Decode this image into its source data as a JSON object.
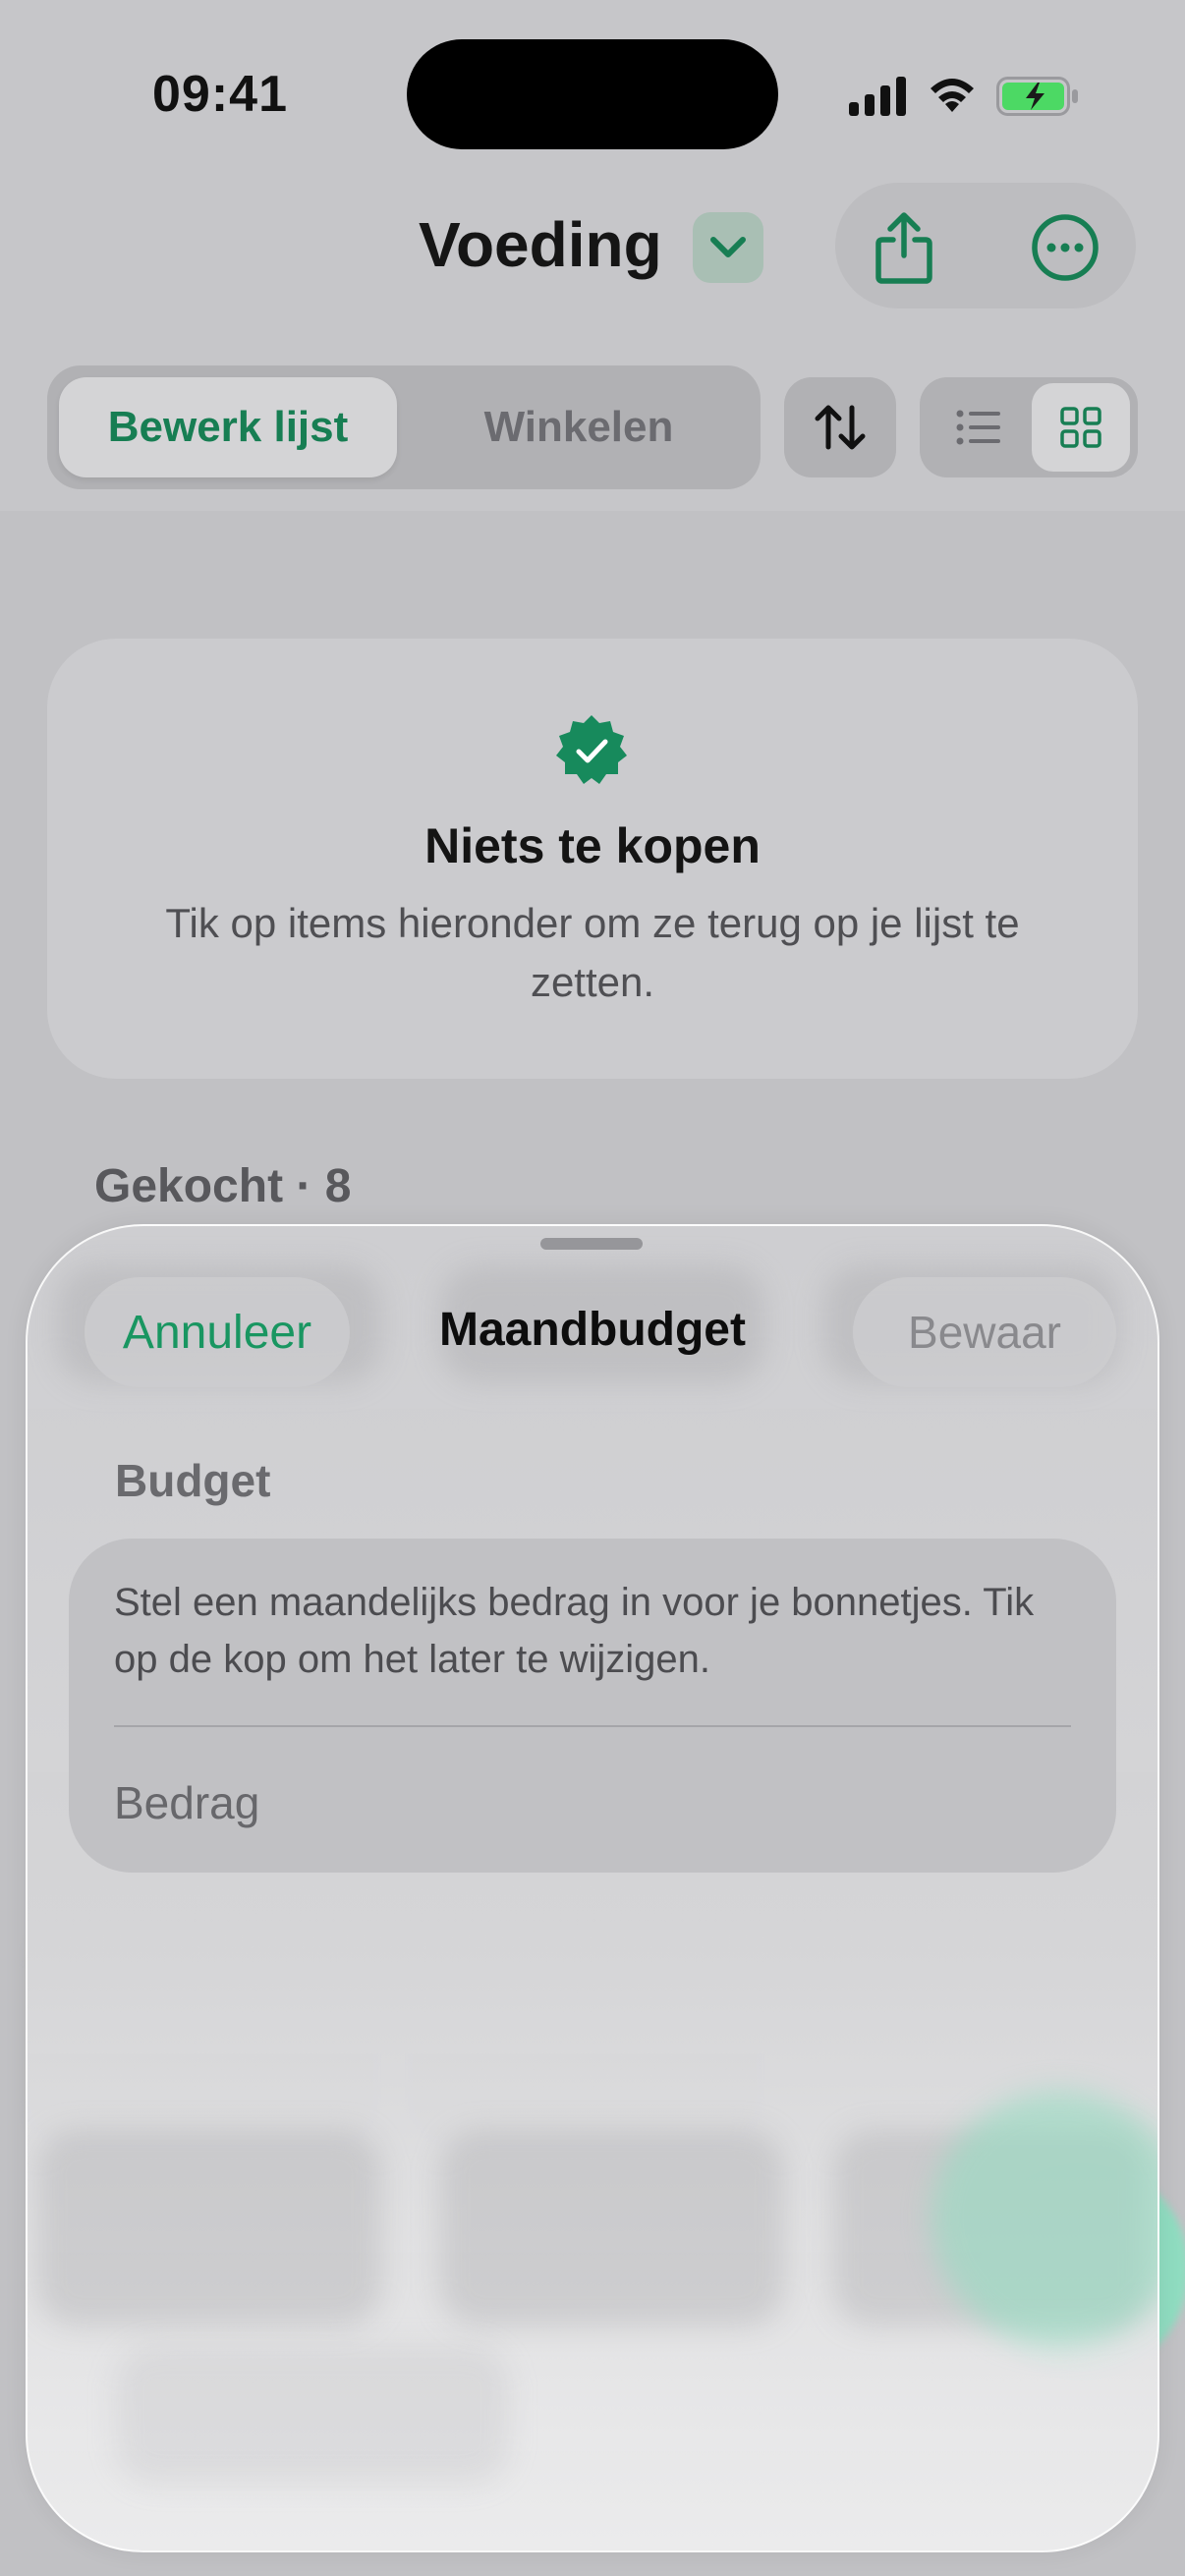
{
  "status_bar": {
    "time": "09:41"
  },
  "nav": {
    "title": "Voeding"
  },
  "toolbar": {
    "tabs": [
      {
        "label": "Bewerk lijst",
        "active": true
      },
      {
        "label": "Winkelen",
        "active": false
      }
    ],
    "view_mode": "grid"
  },
  "empty_state": {
    "title": "Niets te kopen",
    "description": "Tik op items hieronder om ze terug op je lijst te zetten."
  },
  "section": {
    "header": "Gekocht · 8"
  },
  "sheet": {
    "cancel_label": "Annuleer",
    "title": "Maandbudget",
    "save_label": "Bewaar",
    "field_label": "Budget",
    "description": "Stel een maandelijks bedrag in voor je bonnetjes. Tik op de kop om het later te wijzigen.",
    "amount_placeholder": "Bedrag"
  },
  "colors": {
    "accent": "#199661",
    "accent_dark": "#177e53",
    "badge": "#178a5c",
    "battery": "#4cd964",
    "fab": "#8fdcc0"
  },
  "icons": [
    "chevron-down-icon",
    "share-icon",
    "ellipsis-circle-icon",
    "sort-arrows-icon",
    "list-icon",
    "grid-icon",
    "verified-badge-icon"
  ]
}
